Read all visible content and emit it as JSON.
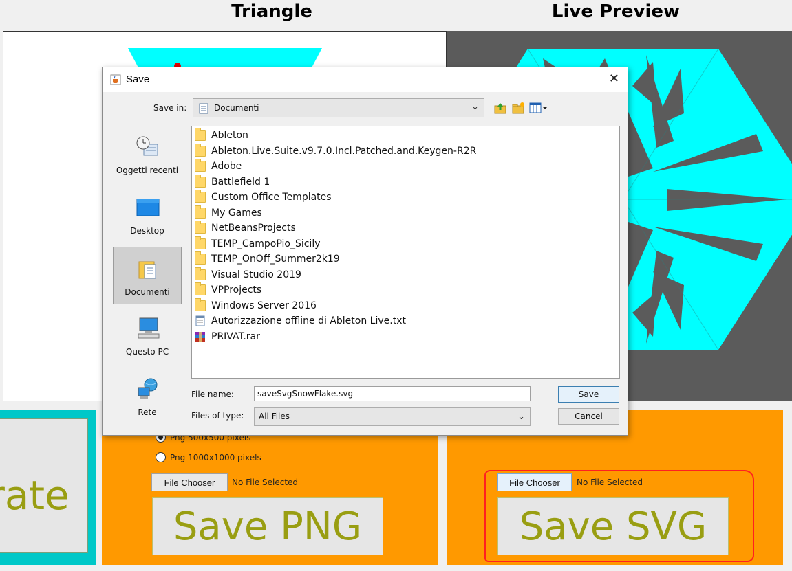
{
  "headers": {
    "triangle": "Triangle",
    "live_preview": "Live Preview"
  },
  "generate": {
    "label": "rate"
  },
  "png_panel": {
    "radio_500": "Png 500x500 pixels",
    "radio_1000": "Png 1000x1000 pixels",
    "file_chooser": "File Chooser",
    "no_file": "No File Selected",
    "save_label": "Save PNG"
  },
  "svg_panel": {
    "file_chooser": "File Chooser",
    "no_file": "No File Selected",
    "save_label": "Save SVG"
  },
  "dialog": {
    "title": "Save",
    "close": "✕",
    "save_in_label": "Save in:",
    "save_in_value": "Documenti",
    "places": [
      {
        "label": "Oggetti recenti",
        "icon": "recent-items-icon"
      },
      {
        "label": "Desktop",
        "icon": "desktop-icon"
      },
      {
        "label": "Documenti",
        "icon": "documents-icon"
      },
      {
        "label": "Questo PC",
        "icon": "computer-icon"
      },
      {
        "label": "Rete",
        "icon": "network-icon"
      }
    ],
    "files": [
      "Ableton",
      "Ableton.Live.Suite.v9.7.0.Incl.Patched.and.Keygen-R2R",
      "Adobe",
      "Battlefield 1",
      "Custom Office Templates",
      "My Games",
      "NetBeansProjects",
      "TEMP_CampoPio_Sicily",
      "TEMP_OnOff_Summer2k19",
      "Visual Studio 2019",
      "VPProjects",
      "Windows Server 2016",
      "Autorizzazione offline di Ableton Live.txt",
      "PRIVAT.rar"
    ],
    "file_name_label": "File name:",
    "file_name_value": "saveSvgSnowFlake.svg",
    "files_of_type_label": "Files of type:",
    "files_of_type_value": "All Files",
    "save_button": "Save",
    "cancel_button": "Cancel"
  },
  "colors": {
    "cyan": "#00ffff",
    "orange": "#ff9900",
    "olive_text": "#999e12",
    "preview_bg": "#5b5b5b",
    "highlight_red": "#ff2020"
  }
}
